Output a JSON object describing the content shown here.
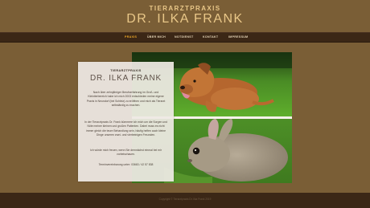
{
  "header": {
    "kicker": "TIERARZTPRAXIS",
    "name": "DR. ILKA FRANK"
  },
  "nav": {
    "items": [
      {
        "label": "PRAXIS",
        "active": true
      },
      {
        "label": "ÜBER MICH",
        "active": false
      },
      {
        "label": "NOTDIENST",
        "active": false
      },
      {
        "label": "KONTAKT",
        "active": false
      },
      {
        "label": "IMPRESSUM",
        "active": false
      }
    ]
  },
  "card": {
    "kicker": "TIERARZTPRAXIS",
    "name": "DR. ILKA FRANK",
    "paragraphs": [
      "Nach über zehnjähriger Berufserfahrung im Groß- und Kleintierbereich habe ich mich 2003 entschieden meine eigene Praxis in Neundorf (bei Schleiz) zu eröffnen und mich als Tierarzt selbständig zu machen.",
      "In der Tierarztpraxis Dr. Frank kümmere ich mich um die Sorgen und Nöte meiner kleinen und großen Patienten. Dabei muss es nicht immer gleich die teure Behandlung sein, häufig helfen auch kleine Dinge unseren zwei- und vierbeinigen Freunden.",
      "Ich würde mich freuen, wenn Sie demnächst einmal bei mir vorbeischauen.",
      "Terminvereinbarung unter: 03663 / 42 57 838"
    ]
  },
  "images": {
    "top": "dog-photo",
    "bottom": "rabbit-photo"
  },
  "footer": {
    "copyright": "Copyright © Tierarztpraxis Dr. Ilka Frank 2019"
  },
  "colors": {
    "background": "#7a5e36",
    "nav_bar": "#3b2716",
    "accent": "#f0a928",
    "brand_text": "#e9c788"
  }
}
